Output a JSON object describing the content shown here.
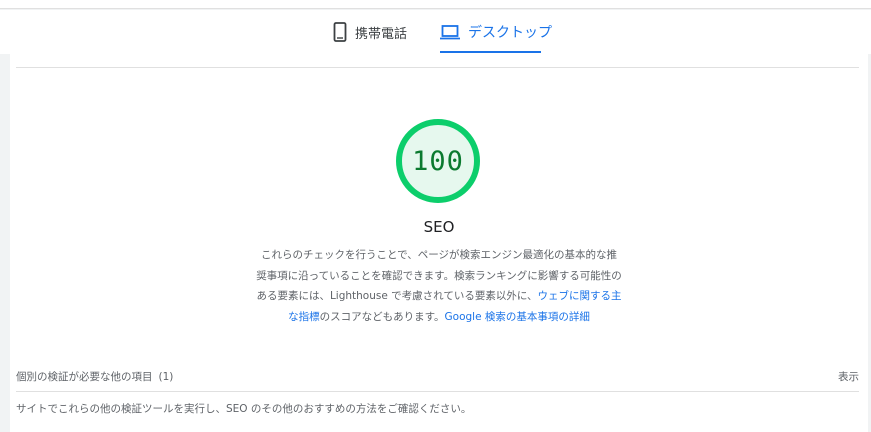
{
  "tabs": {
    "mobile_label": "携帯電話",
    "desktop_label": "デスクトップ",
    "active": "desktop"
  },
  "category": {
    "score": "100",
    "score_value": 100,
    "title": "SEO",
    "description_plain": "これらのチェックを行うことで、ページが検索エンジン最適化の基本的な推奨事項に沿っていることを確認できます。検索ランキングに影響する可能性のある要素には、Lighthouse で考慮されている要素以外に、",
    "link_web_vitals": "ウェブに関する主な指標",
    "description_mid": "のスコアなどもあります。",
    "link_google": "Google 検索の基本事項の詳細"
  },
  "manual": {
    "label": "個別の検証が必要な他の項目",
    "count": "(1)",
    "show_label": "表示",
    "text": "サイトでこれらの他の検証ツールを実行し、SEO のその他のおすすめの方法をご確認ください。"
  },
  "colors": {
    "accent": "#1a73e8",
    "pass_green": "#0cce6b",
    "pass_fill": "#e6f8ee",
    "pass_text": "#0b7a2f"
  },
  "icons": {
    "mobile": "phone-icon",
    "desktop": "laptop-icon"
  }
}
